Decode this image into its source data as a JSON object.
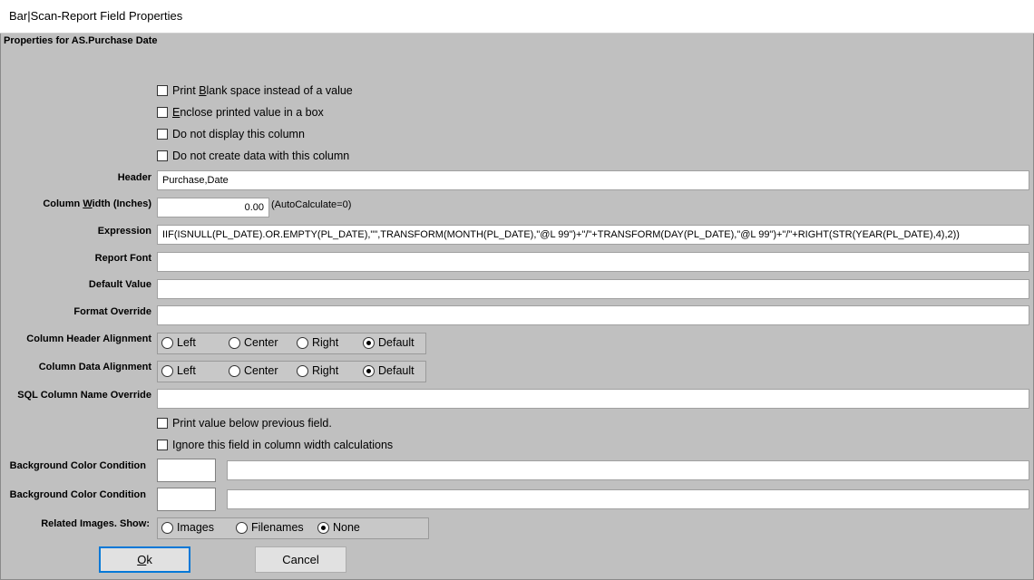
{
  "window": {
    "title": "Bar|Scan-Report Field Properties"
  },
  "dialog": {
    "caption": "Properties for AS.Purchase Date"
  },
  "checkboxes_top": [
    {
      "pre": "Print ",
      "u": "B",
      "post": "lank space instead of a value",
      "checked": false
    },
    {
      "pre": "",
      "u": "E",
      "post": "nclose printed value in a box",
      "checked": false
    },
    {
      "pre": "Do not display this column",
      "u": "",
      "post": "",
      "checked": false
    },
    {
      "pre": "Do not create data with this column",
      "u": "",
      "post": "",
      "checked": false
    }
  ],
  "fields": {
    "header": {
      "label": "Header",
      "value": "Purchase,Date"
    },
    "column_width": {
      "label_pre": "Column ",
      "label_u": "W",
      "label_post": "idth (Inches)",
      "value": "0.00",
      "note": "(AutoCalculate=0)"
    },
    "expression": {
      "label": "Expression",
      "value": "IIF(ISNULL(PL_DATE).OR.EMPTY(PL_DATE),\"\",TRANSFORM(MONTH(PL_DATE),\"@L 99\")+\"/\"+TRANSFORM(DAY(PL_DATE),\"@L 99\")+\"/\"+RIGHT(STR(YEAR(PL_DATE),4),2))"
    },
    "report_font": {
      "label": "Report Font",
      "value": ""
    },
    "default_value": {
      "label": "Default Value",
      "value": ""
    },
    "format_override": {
      "label": "Format Override",
      "value": ""
    },
    "sql_override": {
      "label": "SQL Column Name Override",
      "value": ""
    }
  },
  "alignment": {
    "header": {
      "label": "Column Header Alignment",
      "options": [
        "Left",
        "Center",
        "Right",
        "Default"
      ],
      "selected": "Default"
    },
    "data": {
      "label": "Column Data Alignment",
      "options": [
        "Left",
        "Center",
        "Right",
        "Default"
      ],
      "selected": "Default"
    }
  },
  "checkboxes_bottom": [
    {
      "label": "Print value below previous field.",
      "checked": false
    },
    {
      "label": "Ignore this field in column width calculations",
      "checked": false
    }
  ],
  "bg_conditions": [
    {
      "label": "Background Color Condition",
      "value": ""
    },
    {
      "label": "Background Color Condition",
      "value": ""
    }
  ],
  "related_images": {
    "label": "Related Images. Show:",
    "options": [
      "Images",
      "Filenames",
      "None"
    ],
    "selected": "None"
  },
  "buttons": {
    "ok": {
      "u": "O",
      "post": "k"
    },
    "cancel": "Cancel"
  }
}
